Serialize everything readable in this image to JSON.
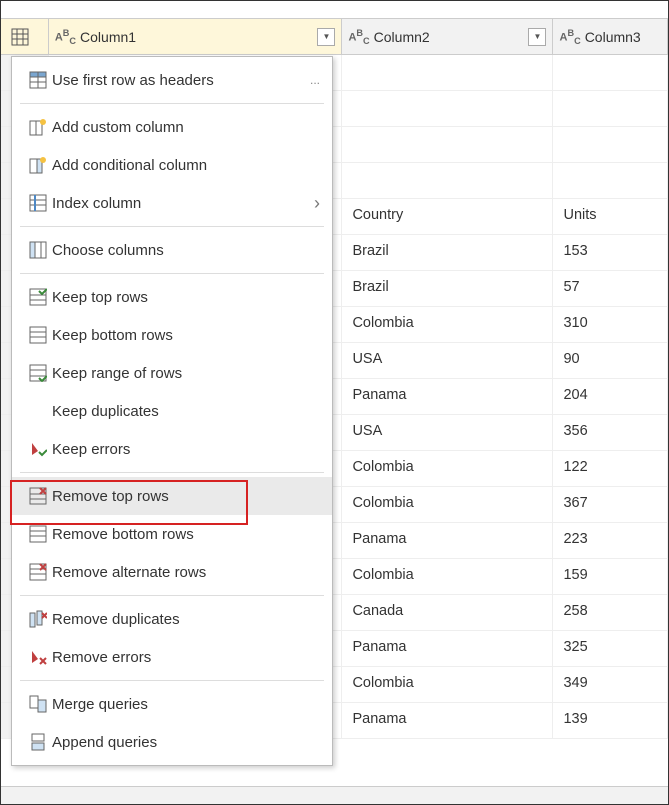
{
  "columns": {
    "col1": {
      "name": "Column1"
    },
    "col2": {
      "name": "Column2"
    },
    "col3": {
      "name": "Column3"
    }
  },
  "ellipsis": "...",
  "menu": {
    "firstRowHeaders": "Use first row as headers",
    "addCustomColumn": "Add custom column",
    "addConditionalColumn": "Add conditional column",
    "indexColumn": "Index column",
    "chooseColumns": "Choose columns",
    "keepTopRows": "Keep top rows",
    "keepBottomRows": "Keep bottom rows",
    "keepRangeRows": "Keep range of rows",
    "keepDuplicates": "Keep duplicates",
    "keepErrors": "Keep errors",
    "removeTopRows": "Remove top rows",
    "removeBottomRows": "Remove bottom rows",
    "removeAlternateRows": "Remove alternate rows",
    "removeDuplicates": "Remove duplicates",
    "removeErrors": "Remove errors",
    "mergeQueries": "Merge queries",
    "appendQueries": "Append queries"
  },
  "table": {
    "rows": [
      {
        "c2": "",
        "c3": ""
      },
      {
        "c2": "",
        "c3": ""
      },
      {
        "c2": "",
        "c3": ""
      },
      {
        "c2": "",
        "c3": ""
      },
      {
        "c2": "Country",
        "c3": "Units"
      },
      {
        "c2": "Brazil",
        "c3": "153"
      },
      {
        "c2": "Brazil",
        "c3": "57"
      },
      {
        "c2": "Colombia",
        "c3": "310"
      },
      {
        "c2": "USA",
        "c3": "90"
      },
      {
        "c2": "Panama",
        "c3": "204"
      },
      {
        "c2": "USA",
        "c3": "356"
      },
      {
        "c2": "Colombia",
        "c3": "122"
      },
      {
        "c2": "Colombia",
        "c3": "367"
      },
      {
        "c2": "Panama",
        "c3": "223"
      },
      {
        "c2": "Colombia",
        "c3": "159"
      },
      {
        "c2": "Canada",
        "c3": "258"
      },
      {
        "c2": "Panama",
        "c3": "325"
      },
      {
        "c2": "Colombia",
        "c3": "349"
      },
      {
        "c2": "Panama",
        "c3": "139"
      }
    ]
  }
}
